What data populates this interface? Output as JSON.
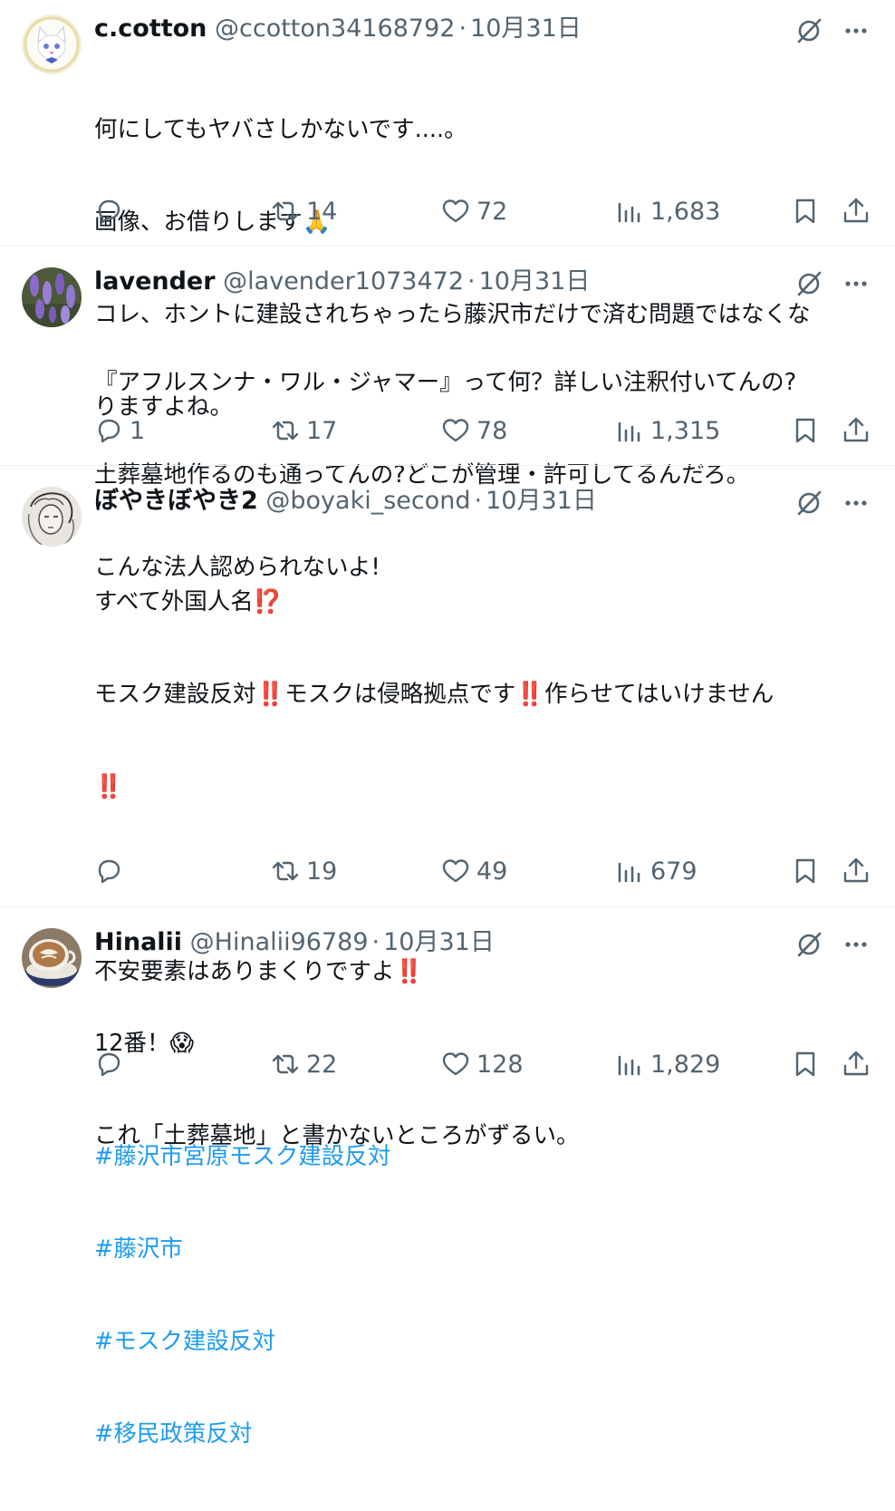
{
  "colors": {
    "text": "#0f1419",
    "secondary": "#536471",
    "hashtag": "#1d9bf0",
    "divider": "#eff3f4",
    "exclamation": "#e0245e"
  },
  "tweets": [
    {
      "name": "c.cotton",
      "handle": "@ccotton34168792",
      "separator": "·",
      "date": "10月31日",
      "avatar_icon": "white-cat-avatar",
      "lines": [
        "何にしてもヤバさしかないです....。",
        "画像、お借りします🙏",
        "コレ、ホントに建設されちゃったら藤沢市だけで済む問題ではなくな",
        "りますよね。"
      ],
      "hashtags": [],
      "reply_count": "",
      "retweet_count": "14",
      "like_count": "72",
      "view_count": "1,683"
    },
    {
      "name": "lavender",
      "handle": "@lavender1073472",
      "separator": "·",
      "date": "10月31日",
      "avatar_icon": "lavender-flowers-avatar",
      "lines": [
        "『アフルスンナ・ワル・ジャマー』って何？詳しい注釈付いてんの?",
        "土葬墓地作るのも通ってんの?どこが管理・許可してるんだろ。",
        "こんな法人認められないよ!"
      ],
      "hashtags": [],
      "reply_count": "1",
      "retweet_count": "17",
      "like_count": "78",
      "view_count": "1,315"
    },
    {
      "name": "ぼやきぼやき2",
      "handle": "@boyaki_second",
      "separator": "·",
      "date": "10月31日",
      "avatar_icon": "manga-sketch-avatar",
      "lines": [
        "すべて外国人名⁉️",
        "モスク建設反対‼️モスクは侵略拠点です‼️作らせてはいけません",
        "‼️",
        "",
        "不安要素はありまくりですよ‼️",
        ""
      ],
      "hashtags": [
        "#藤沢市宮原モスク建設反対",
        "#藤沢市",
        "#モスク建設反対",
        "#移民政策反対"
      ],
      "reply_count": "",
      "retweet_count": "19",
      "like_count": "49",
      "view_count": "679"
    },
    {
      "name": "Hinalii",
      "handle": "@Hinalii96789",
      "separator": "·",
      "date": "10月31日",
      "avatar_icon": "latte-cup-avatar",
      "lines": [
        "12番！😱",
        "これ「土葬墓地」と書かないところがずるい。"
      ],
      "hashtags": [],
      "reply_count": "",
      "retweet_count": "22",
      "like_count": "128",
      "view_count": "1,829"
    }
  ]
}
